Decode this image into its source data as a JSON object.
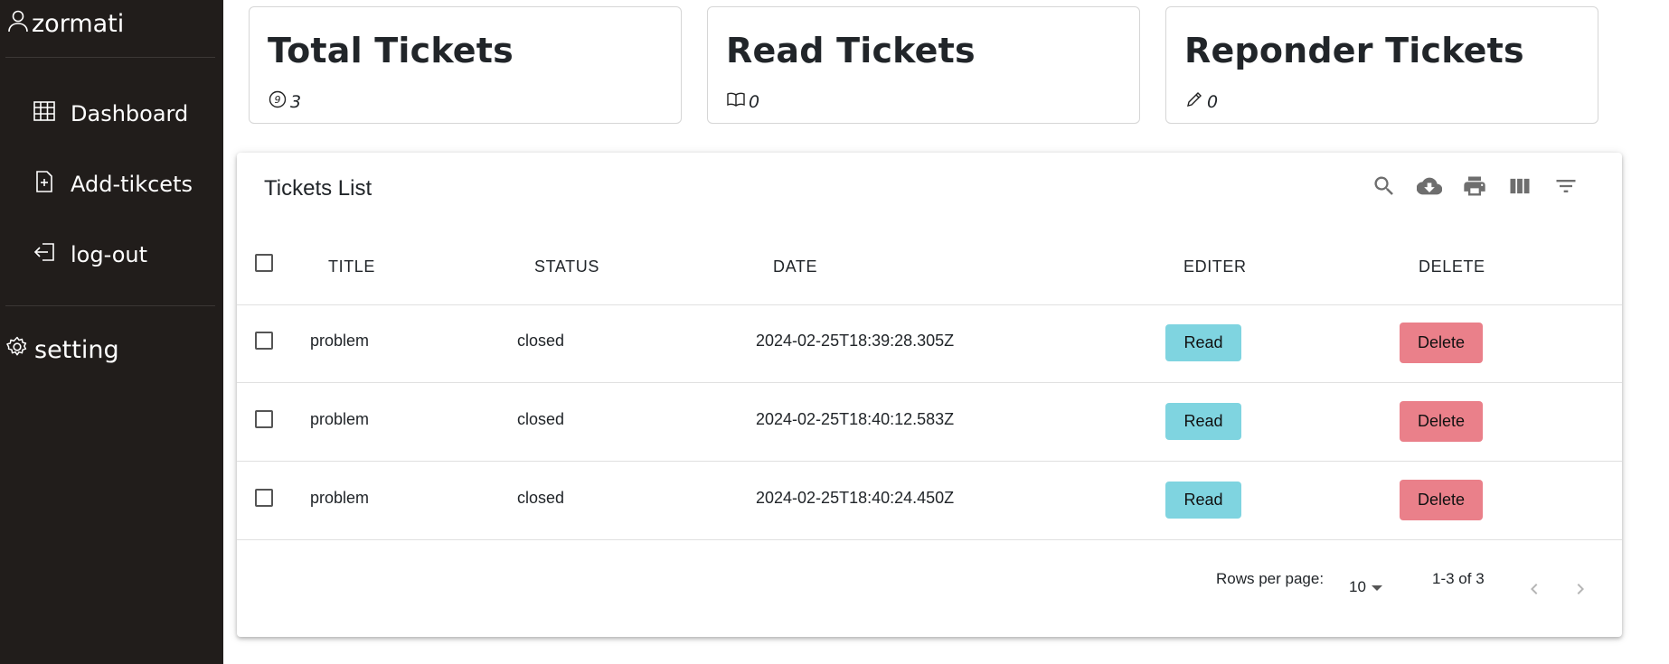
{
  "sidebar": {
    "user": "zormati",
    "items": [
      {
        "label": "Dashboard",
        "icon": "table-icon"
      },
      {
        "label": "Add-tikcets",
        "icon": "file-plus-icon"
      },
      {
        "label": "log-out",
        "icon": "logout-icon"
      }
    ],
    "setting": "setting"
  },
  "cards": [
    {
      "title": "Total Tickets",
      "value": "3",
      "icon": "circle-9-icon"
    },
    {
      "title": "Read Tickets",
      "value": "0",
      "icon": "book-icon"
    },
    {
      "title": "Reponder Tickets",
      "value": "0",
      "icon": "pencil-icon"
    }
  ],
  "table": {
    "title": "Tickets List",
    "toolbar": [
      "search-icon",
      "cloud-download-icon",
      "print-icon",
      "view-columns-icon",
      "filter-icon"
    ],
    "columns": [
      "TITLE",
      "STATUS",
      "DATE",
      "EDITER",
      "DELETE"
    ],
    "rows": [
      {
        "title": "problem",
        "status": "closed",
        "date": "2024-02-25T18:39:28.305Z",
        "read": "Read",
        "delete": "Delete"
      },
      {
        "title": "problem",
        "status": "closed",
        "date": "2024-02-25T18:40:12.583Z",
        "read": "Read",
        "delete": "Delete"
      },
      {
        "title": "problem",
        "status": "closed",
        "date": "2024-02-25T18:40:24.450Z",
        "read": "Read",
        "delete": "Delete"
      }
    ],
    "footer": {
      "rows_per_page_label": "Rows per page:",
      "rows_per_page": "10",
      "range": "1-3 of 3"
    }
  },
  "colors": {
    "sidebar_bg": "#211d1b",
    "read_button": "#7fd4e0",
    "delete_button": "#ea808a"
  }
}
